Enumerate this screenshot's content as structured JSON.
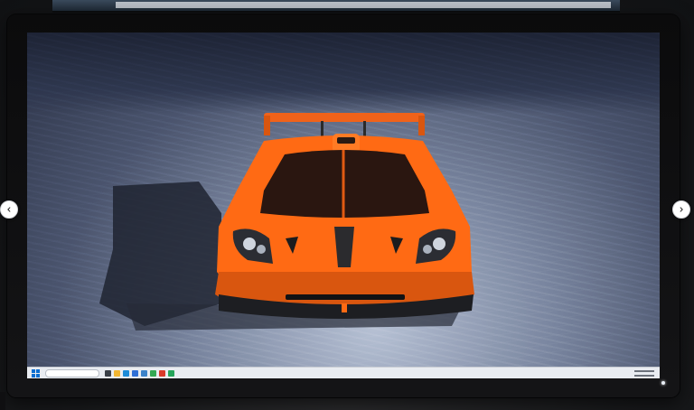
{
  "photo": {
    "subject": "orange-hypercar-wallpaper",
    "colors": {
      "car_body": "#ff6a14",
      "car_dark": "#1b1b1d",
      "floor": "#7f8ba4",
      "sky": "#1e2436"
    }
  },
  "taskbar": {
    "start_icon": "windows-start-icon",
    "search_placeholder": "",
    "app_icons": [
      {
        "name": "task-view-icon",
        "color": "#3a3f47"
      },
      {
        "name": "file-explorer-icon",
        "color": "#f2b632"
      },
      {
        "name": "edge-icon",
        "color": "#1c8bd8"
      },
      {
        "name": "store-icon",
        "color": "#2f6fd6"
      },
      {
        "name": "mail-icon",
        "color": "#3b82c9"
      },
      {
        "name": "chrome-icon",
        "color": "#34a853"
      },
      {
        "name": "app-red-icon",
        "color": "#d93a2a"
      },
      {
        "name": "app-green-icon",
        "color": "#25a45a"
      }
    ]
  },
  "gallery_nav": {
    "prev_icon": "chevron-left-icon",
    "next_icon": "chevron-right-icon"
  }
}
